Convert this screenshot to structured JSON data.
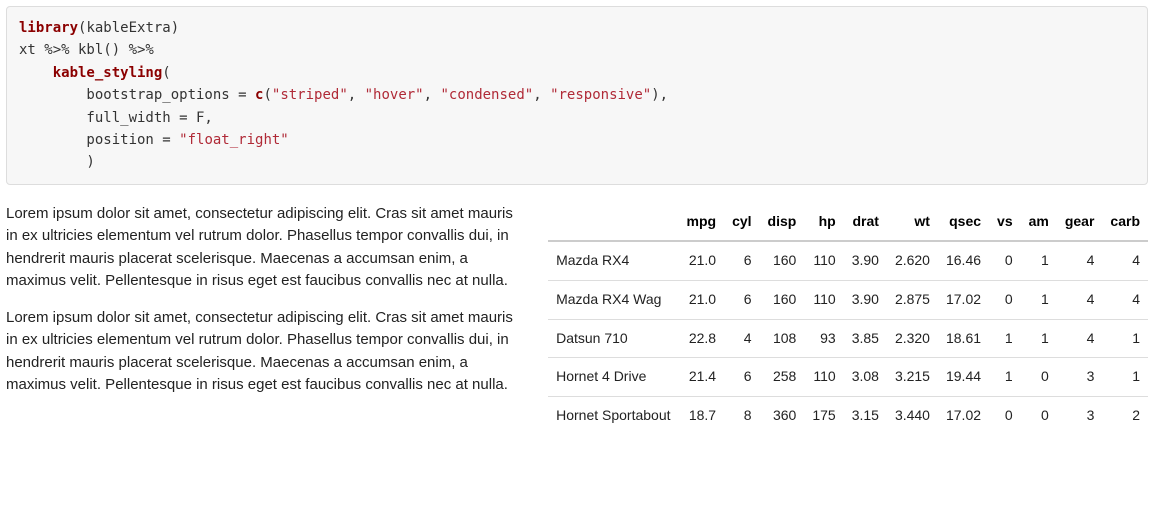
{
  "code": {
    "line1_kw": "library",
    "line1_rest": "(kableExtra)",
    "line2": "xt %>% kbl() %>% ",
    "line3_indent": "    ",
    "line3_fun": "kable_styling",
    "line3_rest": "(",
    "line4_a": "        bootstrap_options = ",
    "line4_fun": "c",
    "line4_p1": "(",
    "line4_s1": "\"striped\"",
    "line4_c1": ", ",
    "line4_s2": "\"hover\"",
    "line4_c2": ", ",
    "line4_s3": "\"condensed\"",
    "line4_c3": ", ",
    "line4_s4": "\"responsive\"",
    "line4_p2": "),",
    "line5": "        full_width = F,",
    "line6_a": "        position = ",
    "line6_s": "\"float_right\"",
    "line7": "        )"
  },
  "chart_data": {
    "type": "table",
    "headers": [
      "",
      "mpg",
      "cyl",
      "disp",
      "hp",
      "drat",
      "wt",
      "qsec",
      "vs",
      "am",
      "gear",
      "carb"
    ],
    "rows": [
      [
        "Mazda RX4",
        "21.0",
        "6",
        "160",
        "110",
        "3.90",
        "2.620",
        "16.46",
        "0",
        "1",
        "4",
        "4"
      ],
      [
        "Mazda RX4 Wag",
        "21.0",
        "6",
        "160",
        "110",
        "3.90",
        "2.875",
        "17.02",
        "0",
        "1",
        "4",
        "4"
      ],
      [
        "Datsun 710",
        "22.8",
        "4",
        "108",
        "93",
        "3.85",
        "2.320",
        "18.61",
        "1",
        "1",
        "4",
        "1"
      ],
      [
        "Hornet 4 Drive",
        "21.4",
        "6",
        "258",
        "110",
        "3.08",
        "3.215",
        "19.44",
        "1",
        "0",
        "3",
        "1"
      ],
      [
        "Hornet Sportabout",
        "18.7",
        "8",
        "360",
        "175",
        "3.15",
        "3.440",
        "17.02",
        "0",
        "0",
        "3",
        "2"
      ]
    ]
  },
  "prose": {
    "p1": "Lorem ipsum dolor sit amet, consectetur adipiscing elit. Cras sit amet mauris in ex ultricies elementum vel rutrum dolor. Phasellus tempor convallis dui, in hendrerit mauris placerat scelerisque. Maecenas a accumsan enim, a maximus velit. Pellentesque in risus eget est faucibus convallis nec at nulla.",
    "p2": "Lorem ipsum dolor sit amet, consectetur adipiscing elit. Cras sit amet mauris in ex ultricies elementum vel rutrum dolor. Phasellus tempor convallis dui, in hendrerit mauris placerat scelerisque. Maecenas a accumsan enim, a maximus velit. Pellentesque in risus eget est faucibus convallis nec at nulla."
  }
}
